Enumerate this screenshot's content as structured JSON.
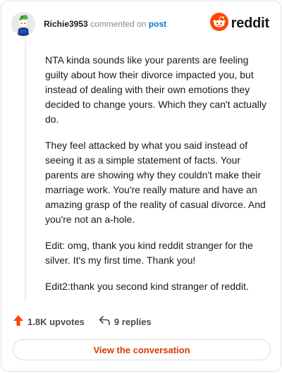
{
  "header": {
    "username": "Richie3953",
    "commented_text": "commented on",
    "post_link": "post",
    "avatar_icon": "snoo-avatar-icon",
    "brand": {
      "icon": "reddit-snoo-logo-icon",
      "wordmark": "reddit",
      "accent_color": "#ff4500"
    }
  },
  "comment": {
    "paragraphs": [
      "NTA kinda sounds like your parents are feeling guilty about how their divorce impacted you, but instead of dealing with their own emotions they decided to change yours. Which they can't actually do.",
      "They feel attacked by what you said instead of seeing it as a simple statement of facts. Your parents are showing why they couldn't make their marriage work. You're really mature and have an amazing grasp of the reality of casual divorce. And you're not an a-hole.",
      "Edit: omg, thank you kind reddit stranger for the silver. It's my first time. Thank you!",
      "Edit2:thank you second kind stranger of reddit."
    ]
  },
  "actions": {
    "upvotes": "1.8K upvotes",
    "upvote_icon": "upvote-arrow-icon",
    "upvote_color": "#ff4500",
    "replies": "9 replies",
    "reply_icon": "reply-arrow-icon"
  },
  "cta": {
    "label": "View the conversation",
    "color": "#d93a00"
  }
}
